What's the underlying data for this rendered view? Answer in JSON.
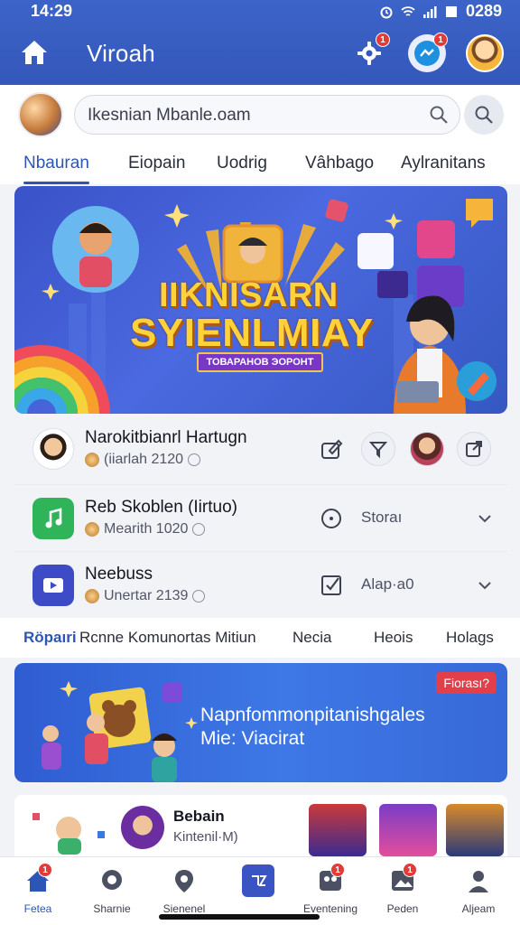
{
  "status_bar": {
    "time": "14:29",
    "battery_text": "0289"
  },
  "app_bar": {
    "title": "Viroah",
    "notification_badge": "1",
    "profile_badge": "1"
  },
  "search": {
    "placeholder": "Ikesnian Mbanle.oam"
  },
  "tabs": [
    {
      "label": "Nbauran",
      "active": true
    },
    {
      "label": "Eiopain"
    },
    {
      "label": "Uodrig"
    },
    {
      "label": "Vâhbago"
    },
    {
      "label": "Aylranitans"
    }
  ],
  "banner": {
    "headline_line1": "IIKNISARN",
    "headline_line2": "SYIENLMIAY",
    "ribbon": "ТОВАРАНОВ ЭОРОНТ"
  },
  "list": [
    {
      "title": "Narokitbianrl Hartugn",
      "meta": "(iiarlah 2120",
      "icon": "person-avatar"
    },
    {
      "title": "Reb Skoblen (Iirtuo)",
      "meta": "Mearith 1020",
      "action_label": "Storaı",
      "icon": "music-note-icon"
    },
    {
      "title": "Neebuss",
      "meta": "Unertar 2139",
      "action_label": "Alap·a0",
      "icon": "video-icon"
    }
  ],
  "subtabs": [
    {
      "label": "Röpaıri",
      "active": true
    },
    {
      "label": "Rcnne Komunortas Mitiun"
    },
    {
      "label": "Necia"
    },
    {
      "label": "Heois"
    },
    {
      "label": "Holags"
    }
  ],
  "promo": {
    "line1": "Napnfommonpitanishgales",
    "line2": "Mie: Viacirat",
    "tag": "Fiorası?"
  },
  "strip": {
    "name": "Bebain",
    "sub": "Kintenil·M)"
  },
  "bottom_nav": [
    {
      "label": "Fetea",
      "icon": "home-icon",
      "active": true,
      "badge": "1"
    },
    {
      "label": "Sharnie",
      "icon": "chat-icon"
    },
    {
      "label": "Sienenel",
      "icon": "location-icon"
    },
    {
      "label": "",
      "icon": "calendar-icon"
    },
    {
      "label": "Eventening",
      "icon": "people-icon",
      "badge": "1"
    },
    {
      "label": "Peden",
      "icon": "photos-icon",
      "badge": "1"
    },
    {
      "label": "Aljeam",
      "icon": "profile-icon"
    }
  ],
  "colors": {
    "primary": "#3457bb",
    "accent": "#2d55b5",
    "badge": "#e33a3a"
  }
}
